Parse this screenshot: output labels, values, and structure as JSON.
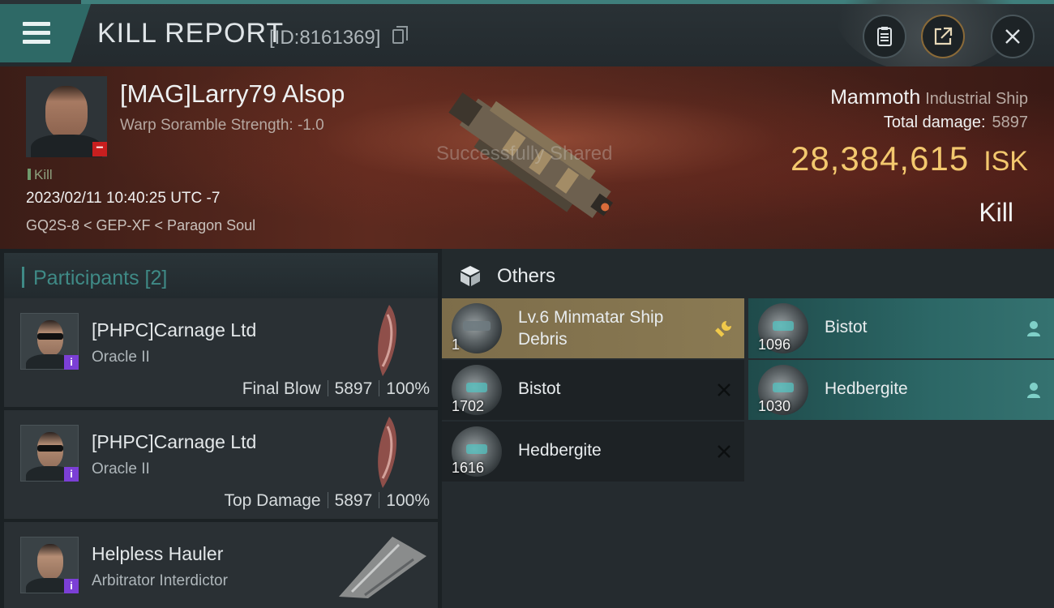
{
  "header": {
    "title": "KILL REPORT",
    "report_id": "[ID:8161369]"
  },
  "victim": {
    "name": "[MAG]Larry79 Alsop",
    "warp_scramble": "Warp Soramble Strength: -1.0",
    "shared_toast": "Successfully Shared",
    "kill_tag": "Kill",
    "datetime": "2023/02/11 10:40:25 UTC -7",
    "location": "GQ2S-8 < GEP-XF < Paragon Soul",
    "ship_name": "Mammoth",
    "ship_class": "Industrial Ship",
    "total_damage_label": "Total damage:",
    "total_damage_value": "5897",
    "isk_value": "28,384,615",
    "isk_unit": "ISK",
    "result": "Kill"
  },
  "participants": {
    "header": "Participants [2]",
    "list": [
      {
        "name": "[PHPC]Carnage Ltd",
        "ship": "Oracle II",
        "role": "Final Blow",
        "damage": "5897",
        "percent": "100%"
      },
      {
        "name": "[PHPC]Carnage Ltd",
        "ship": "Oracle II",
        "role": "Top Damage",
        "damage": "5897",
        "percent": "100%"
      },
      {
        "name": "Helpless Hauler",
        "ship": "Arbitrator Interdictor"
      }
    ]
  },
  "others": {
    "header": "Others",
    "items": [
      {
        "name": "Lv.6 Minmatar Ship Debris",
        "qty": "1",
        "action_icon": "wrench-icon"
      },
      {
        "name": "Bistot",
        "qty": "1096",
        "action_icon": "person-icon"
      },
      {
        "name": "Bistot",
        "qty": "1702",
        "action_icon": "close-icon"
      },
      {
        "name": "Hedbergite",
        "qty": "1030",
        "action_icon": "person-icon"
      },
      {
        "name": "Hedbergite",
        "qty": "1616",
        "action_icon": "close-icon"
      }
    ]
  },
  "colors": {
    "accent_teal": "#3f8a86",
    "isk_gold": "#f3c86e",
    "highlight_gold": "#8a7a53",
    "badge_purple": "#7b3fd6",
    "badge_red": "#c81f1f"
  }
}
